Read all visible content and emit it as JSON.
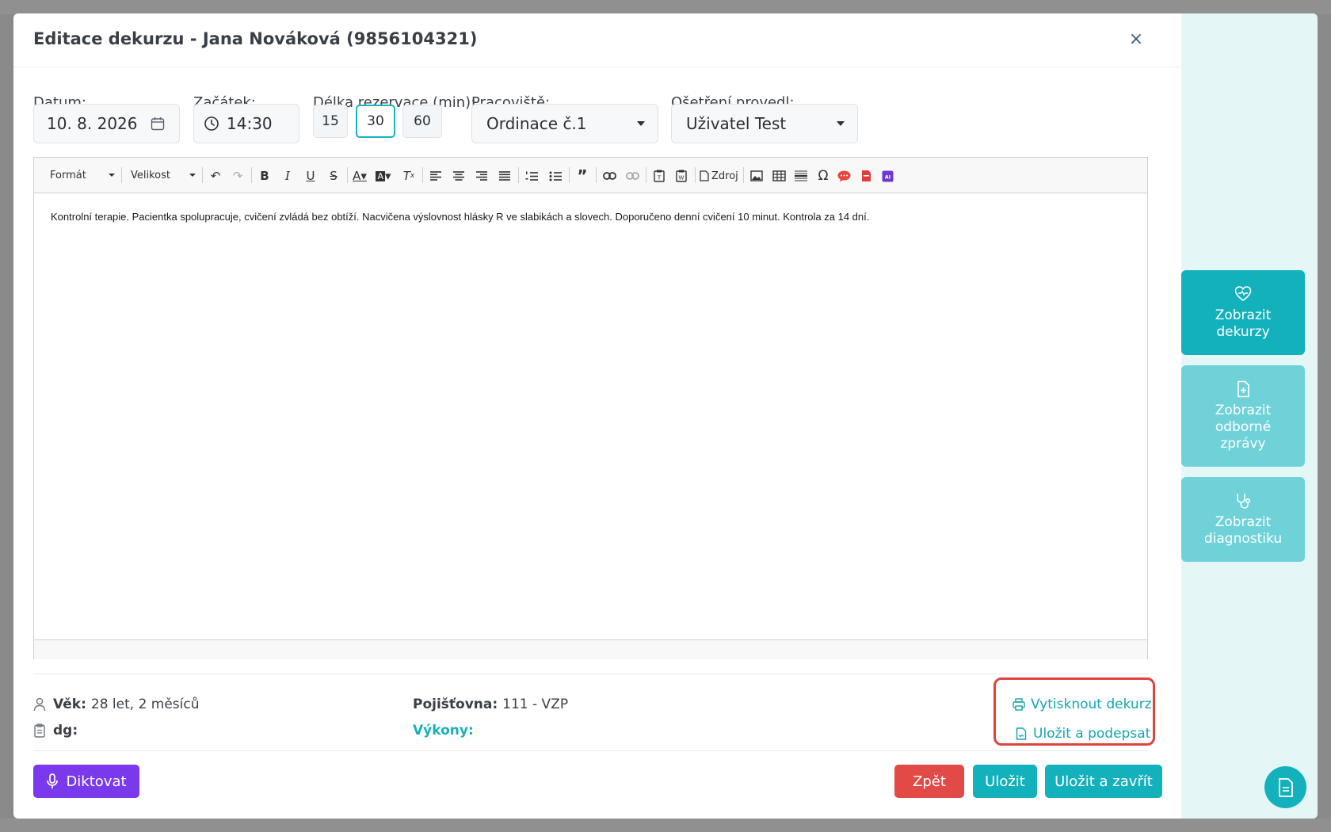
{
  "modal": {
    "title": "Editace dekurzu - Jana Nováková (9856104321)",
    "close_label": "×"
  },
  "form": {
    "date_label": "Datum:",
    "date_value": "10. 8. 2026",
    "start_label": "Začátek:",
    "start_value": "14:30",
    "duration_label": "Délka rezervace (min):",
    "durations": [
      "15",
      "30",
      "60"
    ],
    "duration_selected": "30",
    "workplace_label": "Pracoviště:",
    "workplace_value": "Ordinace č.1",
    "performer_label": "Ošetření provedl:",
    "performer_value": "Uživatel Test"
  },
  "editor": {
    "format_label": "Formát",
    "size_label": "Velikost",
    "source_label": "Zdroj",
    "content": "Kontrolní terapie. Pacientka spolupracuje, cvičení zvládá bez obtíží. Nacvičena výslovnost hlásky R ve slabikách a slovech. Doporučeno denní cvičení 10 minut. Kontrola za 14 dní."
  },
  "patient_info": {
    "age_label": "Věk:",
    "age_value": "28 let, 2 měsíců",
    "dg_label": "dg:",
    "insurance_label": "Pojišťovna:",
    "insurance_value": "111 - VZP",
    "procedures_label": "Výkony:"
  },
  "actions": {
    "print_label": "Vytisknout dekurz",
    "sign_label": "Uložit a podepsat",
    "dictate_label": "Diktovat",
    "back_label": "Zpět",
    "save_label": "Uložit",
    "save_close_label": "Uložit a zavřít"
  },
  "side_panel": {
    "show_records_line1": "Zobrazit",
    "show_records_line2": "dekurzy",
    "show_reports_line1": "Zobrazit",
    "show_reports_line2": "odborné",
    "show_reports_line3": "zprávy",
    "show_diagnostics_line1": "Zobrazit",
    "show_diagnostics_line2": "diagnostiku"
  },
  "colors": {
    "accent": "#13b1bb",
    "danger": "#e24a47",
    "dictate": "#7a39ea",
    "highlight": "#e0443d"
  }
}
